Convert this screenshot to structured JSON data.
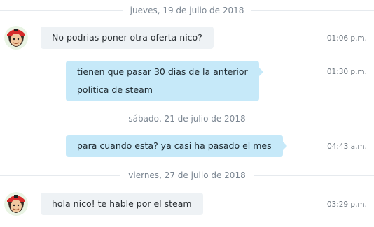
{
  "conversation": {
    "groups": [
      {
        "date": "jueves, 19 de julio de 2018",
        "messages": [
          {
            "direction": "in",
            "lines": [
              "No podrias poner otra oferta nico?"
            ],
            "time": "01:06 p.m."
          },
          {
            "direction": "out",
            "lines": [
              "tienen que pasar 30 dias de la anterior",
              "politica de steam"
            ],
            "time": "01:30 p.m."
          }
        ]
      },
      {
        "date": "sábado, 21 de julio de 2018",
        "messages": [
          {
            "direction": "out",
            "lines": [
              "para cuando esta? ya casi ha pasado el mes"
            ],
            "time": "04:43 a.m."
          }
        ]
      },
      {
        "date": "viernes, 27 de julio de 2018",
        "messages": [
          {
            "direction": "in",
            "lines": [
              "hola nico! te hable por el steam"
            ],
            "time": "03:29 p.m."
          }
        ]
      }
    ]
  },
  "colors": {
    "incoming_bubble": "#eef2f5",
    "outgoing_bubble": "#c6e9f9",
    "separator_line": "#e6eaee",
    "date_text": "#7a8591"
  },
  "icons": {
    "avatar": "contact-avatar-icon"
  }
}
